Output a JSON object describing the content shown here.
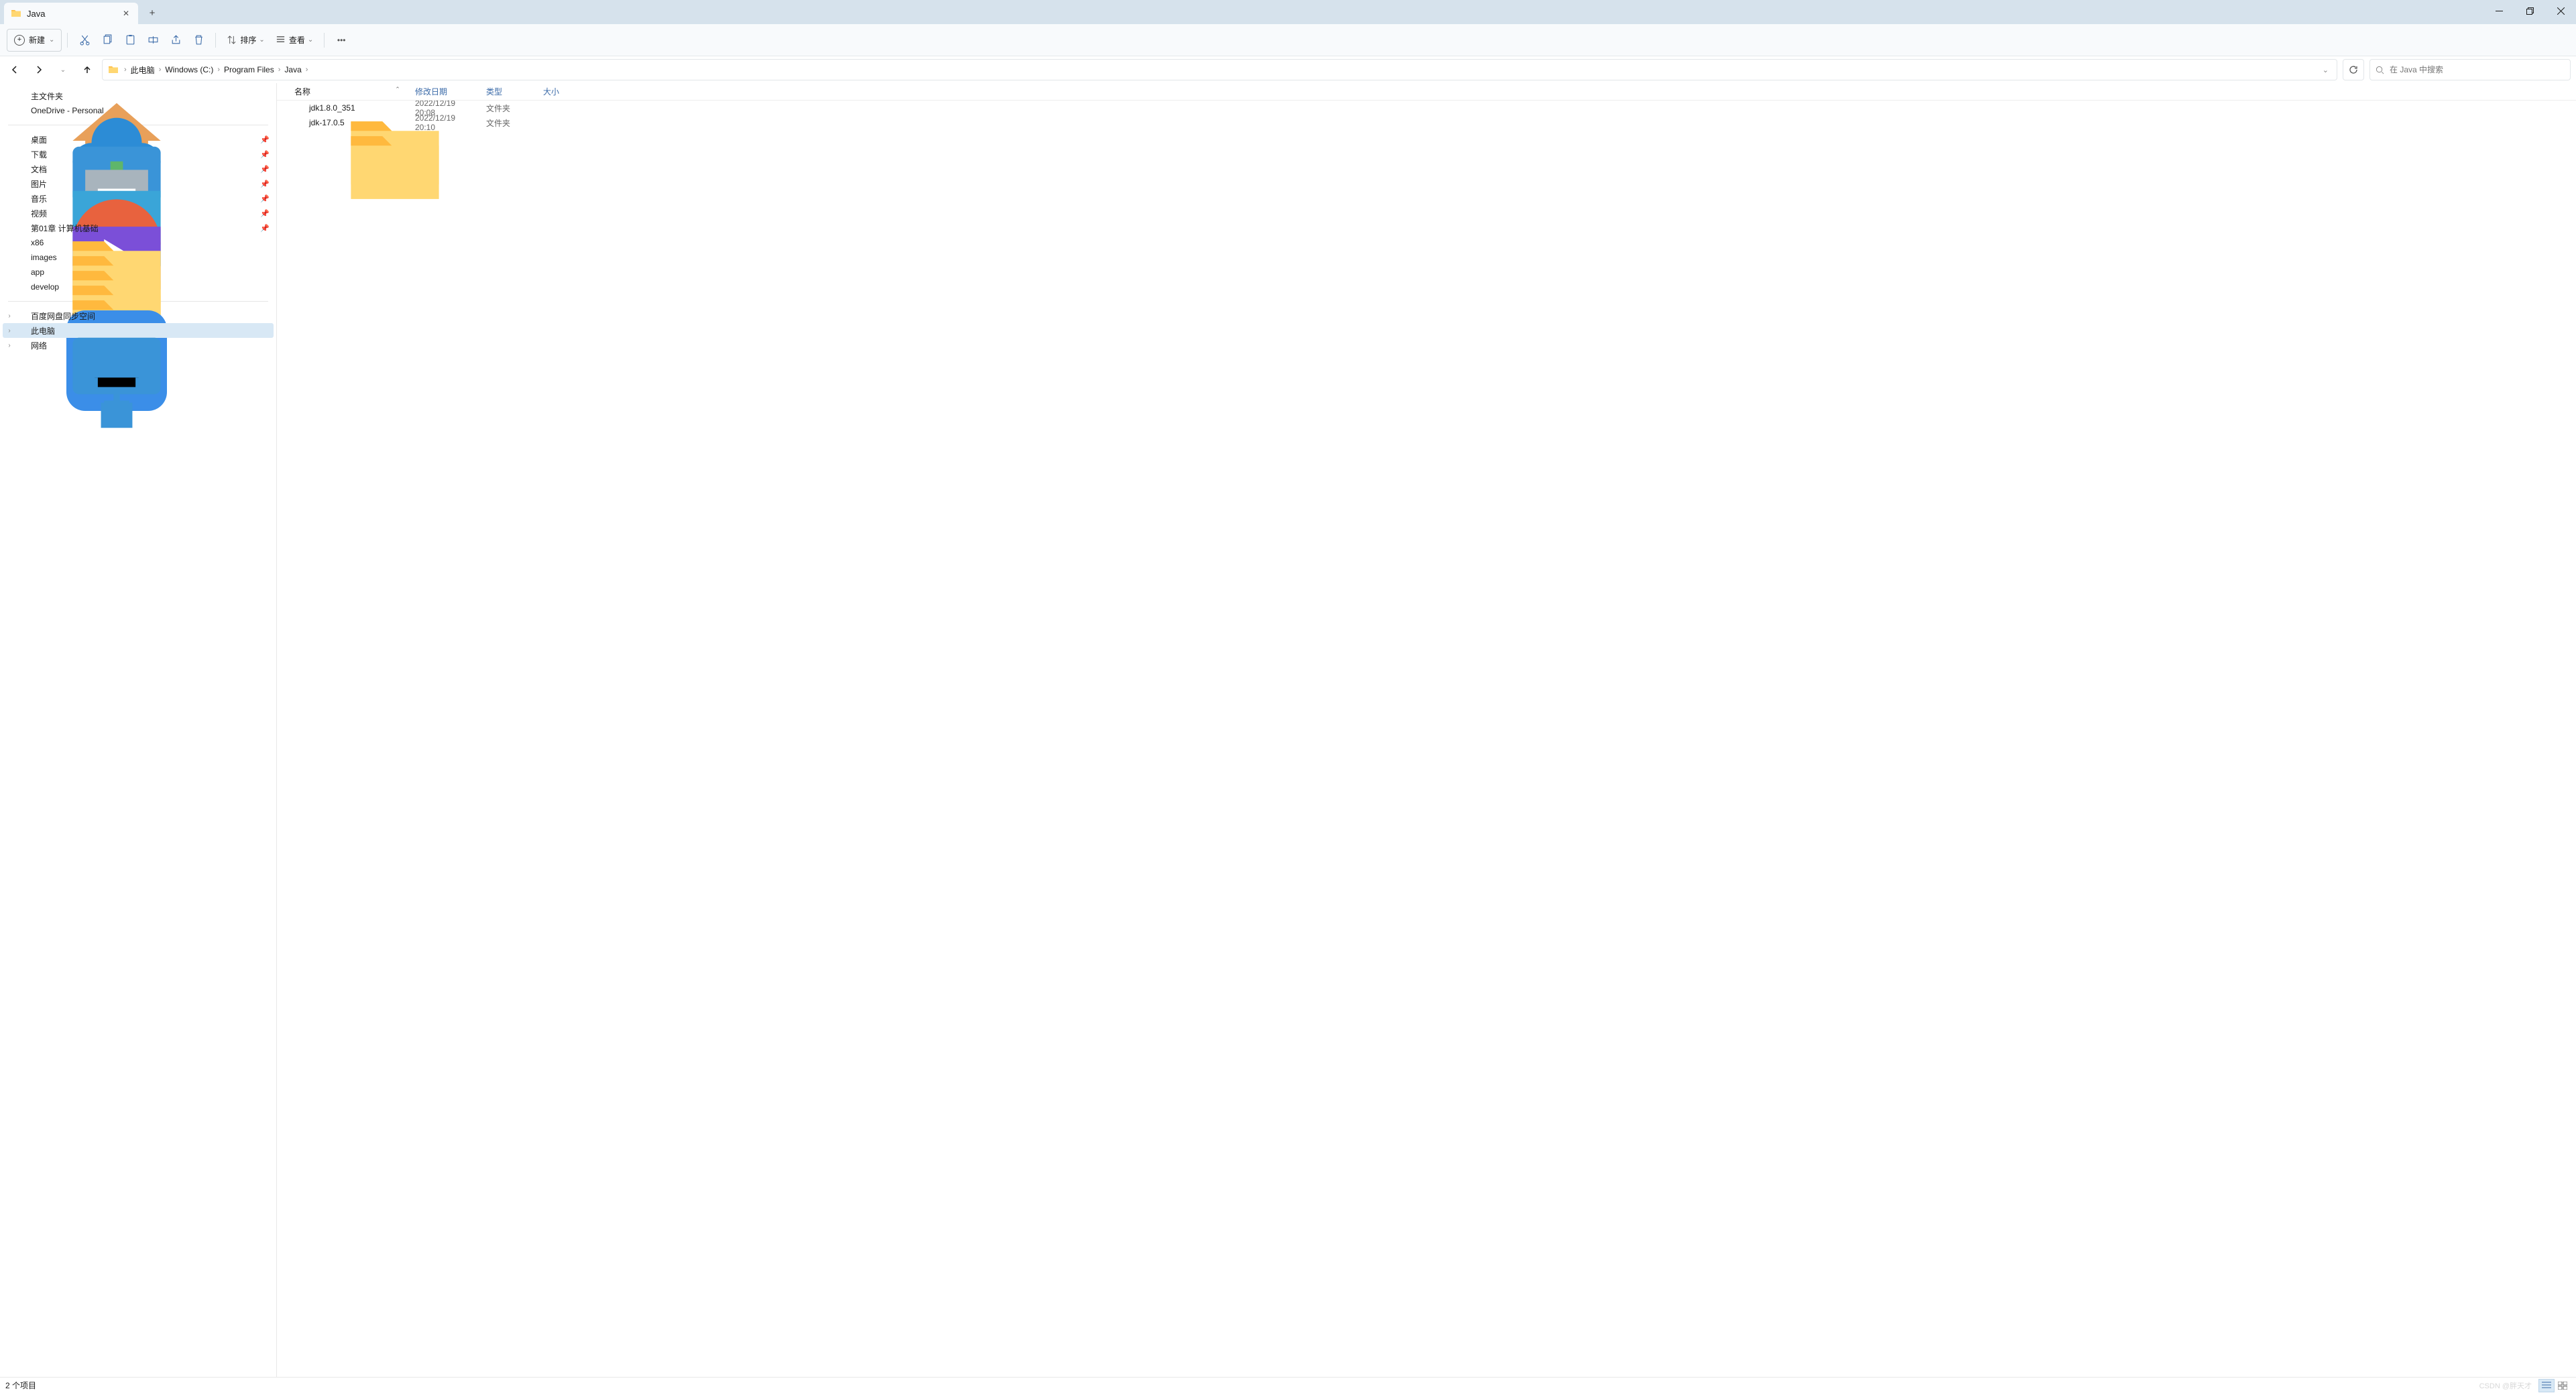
{
  "tab": {
    "title": "Java"
  },
  "toolbar": {
    "new_label": "新建",
    "sort_label": "排序",
    "view_label": "查看"
  },
  "breadcrumb": [
    {
      "label": "此电脑"
    },
    {
      "label": "Windows (C:)"
    },
    {
      "label": "Program Files"
    },
    {
      "label": "Java"
    }
  ],
  "search": {
    "placeholder": "在 Java 中搜索"
  },
  "sidebar": {
    "home": "主文件夹",
    "onedrive": "OneDrive - Personal",
    "quick": [
      {
        "label": "桌面",
        "icon": "desktop",
        "pinned": true
      },
      {
        "label": "下载",
        "icon": "downloads",
        "pinned": true
      },
      {
        "label": "文档",
        "icon": "documents",
        "pinned": true
      },
      {
        "label": "图片",
        "icon": "pictures",
        "pinned": true
      },
      {
        "label": "音乐",
        "icon": "music",
        "pinned": true
      },
      {
        "label": "视频",
        "icon": "videos",
        "pinned": true
      },
      {
        "label": "第01章 计算机基础",
        "icon": "folder",
        "pinned": true
      },
      {
        "label": "x86",
        "icon": "folder",
        "pinned": false
      },
      {
        "label": "images",
        "icon": "folder",
        "pinned": false
      },
      {
        "label": "app",
        "icon": "folder",
        "pinned": false
      },
      {
        "label": "develop",
        "icon": "folder",
        "pinned": false
      }
    ],
    "tree": [
      {
        "label": "百度网盘同步空间",
        "icon": "baidu"
      },
      {
        "label": "此电脑",
        "icon": "pc",
        "selected": true
      },
      {
        "label": "网络",
        "icon": "network"
      }
    ]
  },
  "columns": {
    "name": "名称",
    "date": "修改日期",
    "type": "类型",
    "size": "大小"
  },
  "files": [
    {
      "name": "jdk1.8.0_351",
      "date": "2022/12/19 20:08",
      "type": "文件夹",
      "size": ""
    },
    {
      "name": "jdk-17.0.5",
      "date": "2022/12/19 20:10",
      "type": "文件夹",
      "size": ""
    }
  ],
  "status": {
    "count": "2 个项目",
    "watermark": "CSDN @胖天才"
  }
}
